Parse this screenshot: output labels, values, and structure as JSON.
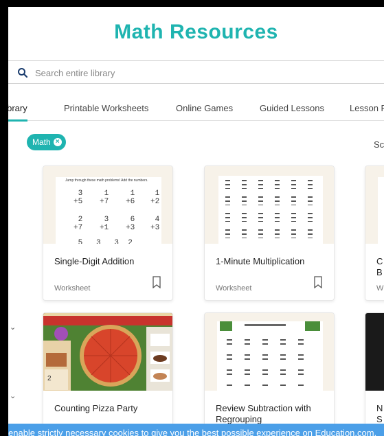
{
  "header": {
    "title": "Math Resources"
  },
  "search": {
    "placeholder": "Search entire library"
  },
  "tabs": [
    {
      "label": "Library"
    },
    {
      "label": "Printable Worksheets"
    },
    {
      "label": "Online Games"
    },
    {
      "label": "Guided Lessons"
    },
    {
      "label": "Lesson P"
    }
  ],
  "filter": {
    "chip_label": "Math"
  },
  "sort": {
    "label": "Sc"
  },
  "cards": [
    {
      "title": "Single-Digit Addition",
      "type": "Worksheet",
      "sheet_heading": "Jump through these math problems! Add the numbers."
    },
    {
      "title": "1-Minute Multiplication",
      "type": "Worksheet"
    },
    {
      "title": "C B",
      "type": "W"
    },
    {
      "title": "Counting Pizza Party",
      "type": ""
    },
    {
      "title": "Review Subtraction with Regrouping",
      "type": ""
    },
    {
      "title": "N S",
      "type": ""
    }
  ],
  "cookie": {
    "text": "enable strictly necessary cookies to give you the best possible experience on Education.com."
  },
  "colors": {
    "accent": "#1fb4b0",
    "cookie_bar": "#4b9fe8",
    "thumb_bg": "#f7f2e9"
  }
}
